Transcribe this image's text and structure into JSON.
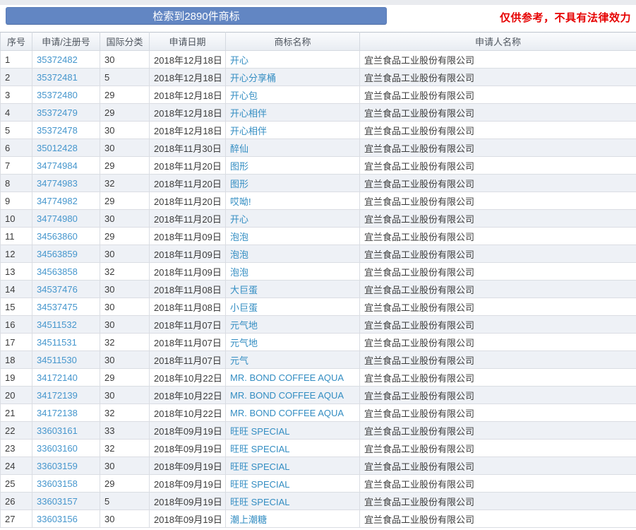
{
  "banner": {
    "label": "检索到2890件商标"
  },
  "disclaimer": "仅供参考，不具有法律效力",
  "colors": {
    "banner_blue": "#6286c3",
    "disclaimer_red": "#e60000",
    "reg_number_blue": "#4596cd",
    "trademark_blue": "#338dc2",
    "even_row_bg": "#eef1f6",
    "header_text": "#4e555e"
  },
  "table": {
    "columns": [
      "序号",
      "申请/注册号",
      "国际分类",
      "申请日期",
      "商标名称",
      "申请人名称"
    ],
    "rows": [
      {
        "no": "1",
        "reg_no": "35372482",
        "intl_class": "30",
        "date": "2018年12月18日",
        "name": "开心",
        "applicant": "宜兰食品工业股份有限公司"
      },
      {
        "no": "2",
        "reg_no": "35372481",
        "intl_class": "5",
        "date": "2018年12月18日",
        "name": "开心分享桶",
        "applicant": "宜兰食品工业股份有限公司"
      },
      {
        "no": "3",
        "reg_no": "35372480",
        "intl_class": "29",
        "date": "2018年12月18日",
        "name": "开心包",
        "applicant": "宜兰食品工业股份有限公司"
      },
      {
        "no": "4",
        "reg_no": "35372479",
        "intl_class": "29",
        "date": "2018年12月18日",
        "name": "开心相伴",
        "applicant": "宜兰食品工业股份有限公司"
      },
      {
        "no": "5",
        "reg_no": "35372478",
        "intl_class": "30",
        "date": "2018年12月18日",
        "name": "开心相伴",
        "applicant": "宜兰食品工业股份有限公司"
      },
      {
        "no": "6",
        "reg_no": "35012428",
        "intl_class": "30",
        "date": "2018年11月30日",
        "name": "醉仙",
        "applicant": "宜兰食品工业股份有限公司"
      },
      {
        "no": "7",
        "reg_no": "34774984",
        "intl_class": "29",
        "date": "2018年11月20日",
        "name": "图形",
        "applicant": "宜兰食品工业股份有限公司"
      },
      {
        "no": "8",
        "reg_no": "34774983",
        "intl_class": "32",
        "date": "2018年11月20日",
        "name": "图形",
        "applicant": "宜兰食品工业股份有限公司"
      },
      {
        "no": "9",
        "reg_no": "34774982",
        "intl_class": "29",
        "date": "2018年11月20日",
        "name": "哎呦!",
        "applicant": "宜兰食品工业股份有限公司"
      },
      {
        "no": "10",
        "reg_no": "34774980",
        "intl_class": "30",
        "date": "2018年11月20日",
        "name": "开心",
        "applicant": "宜兰食品工业股份有限公司"
      },
      {
        "no": "11",
        "reg_no": "34563860",
        "intl_class": "29",
        "date": "2018年11月09日",
        "name": "泡泡",
        "applicant": "宜兰食品工业股份有限公司"
      },
      {
        "no": "12",
        "reg_no": "34563859",
        "intl_class": "30",
        "date": "2018年11月09日",
        "name": "泡泡",
        "applicant": "宜兰食品工业股份有限公司"
      },
      {
        "no": "13",
        "reg_no": "34563858",
        "intl_class": "32",
        "date": "2018年11月09日",
        "name": "泡泡",
        "applicant": "宜兰食品工业股份有限公司"
      },
      {
        "no": "14",
        "reg_no": "34537476",
        "intl_class": "30",
        "date": "2018年11月08日",
        "name": "大巨蛋",
        "applicant": "宜兰食品工业股份有限公司"
      },
      {
        "no": "15",
        "reg_no": "34537475",
        "intl_class": "30",
        "date": "2018年11月08日",
        "name": "小巨蛋",
        "applicant": "宜兰食品工业股份有限公司"
      },
      {
        "no": "16",
        "reg_no": "34511532",
        "intl_class": "30",
        "date": "2018年11月07日",
        "name": "元气地",
        "applicant": "宜兰食品工业股份有限公司"
      },
      {
        "no": "17",
        "reg_no": "34511531",
        "intl_class": "32",
        "date": "2018年11月07日",
        "name": "元气地",
        "applicant": "宜兰食品工业股份有限公司"
      },
      {
        "no": "18",
        "reg_no": "34511530",
        "intl_class": "30",
        "date": "2018年11月07日",
        "name": "元气",
        "applicant": "宜兰食品工业股份有限公司"
      },
      {
        "no": "19",
        "reg_no": "34172140",
        "intl_class": "29",
        "date": "2018年10月22日",
        "name": "MR. BOND COFFEE AQUA",
        "applicant": "宜兰食品工业股份有限公司"
      },
      {
        "no": "20",
        "reg_no": "34172139",
        "intl_class": "30",
        "date": "2018年10月22日",
        "name": "MR. BOND COFFEE AQUA",
        "applicant": "宜兰食品工业股份有限公司"
      },
      {
        "no": "21",
        "reg_no": "34172138",
        "intl_class": "32",
        "date": "2018年10月22日",
        "name": "MR. BOND COFFEE AQUA",
        "applicant": "宜兰食品工业股份有限公司"
      },
      {
        "no": "22",
        "reg_no": "33603161",
        "intl_class": "33",
        "date": "2018年09月19日",
        "name": "旺旺 SPECIAL",
        "applicant": "宜兰食品工业股份有限公司"
      },
      {
        "no": "23",
        "reg_no": "33603160",
        "intl_class": "32",
        "date": "2018年09月19日",
        "name": "旺旺 SPECIAL",
        "applicant": "宜兰食品工业股份有限公司"
      },
      {
        "no": "24",
        "reg_no": "33603159",
        "intl_class": "30",
        "date": "2018年09月19日",
        "name": "旺旺 SPECIAL",
        "applicant": "宜兰食品工业股份有限公司"
      },
      {
        "no": "25",
        "reg_no": "33603158",
        "intl_class": "29",
        "date": "2018年09月19日",
        "name": "旺旺 SPECIAL",
        "applicant": "宜兰食品工业股份有限公司"
      },
      {
        "no": "26",
        "reg_no": "33603157",
        "intl_class": "5",
        "date": "2018年09月19日",
        "name": "旺旺 SPECIAL",
        "applicant": "宜兰食品工业股份有限公司"
      },
      {
        "no": "27",
        "reg_no": "33603156",
        "intl_class": "30",
        "date": "2018年09月19日",
        "name": "潮上潮糖",
        "applicant": "宜兰食品工业股份有限公司"
      }
    ]
  }
}
